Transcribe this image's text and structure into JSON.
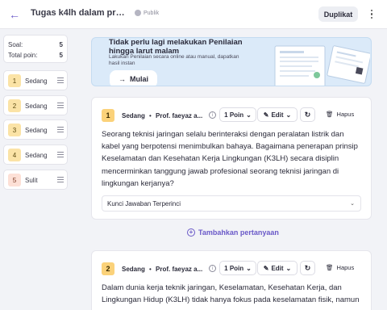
{
  "header": {
    "title": "Tugas k4lh dalam profesi d...",
    "visibility": "Publik",
    "duplicate_label": "Duplikat"
  },
  "stats": {
    "soal_label": "Soal:",
    "soal_value": "5",
    "poin_label": "Total poin:",
    "poin_value": "5"
  },
  "sidebar": {
    "items": [
      {
        "number": "1",
        "difficulty": "Sedang"
      },
      {
        "number": "2",
        "difficulty": "Sedang"
      },
      {
        "number": "3",
        "difficulty": "Sedang"
      },
      {
        "number": "4",
        "difficulty": "Sedang"
      },
      {
        "number": "5",
        "difficulty": "Sulit"
      }
    ]
  },
  "banner": {
    "title": "Tidak perlu lagi melakukan Penilaian hingga larut malam",
    "subtitle": "Lakukan Penilaian secara online atau manual, dapatkan hasil instan",
    "button": "Mulai"
  },
  "questions": [
    {
      "number": "1",
      "difficulty": "Sedang",
      "author": "Prof. faeyaz a...",
      "points": "1 Poin",
      "edit": "Edit",
      "delete": "Hapus",
      "text": "Seorang teknisi jaringan selalu berinteraksi dengan peralatan listrik dan kabel yang berpotensi menimbulkan bahaya. Bagaimana penerapan prinsip Keselamatan dan Kesehatan Kerja Lingkungan (K3LH) secara disiplin mencerminkan tanggung jawab profesional seorang teknisi jaringan di lingkungan kerjanya?",
      "answer_label": "Kunci Jawaban Terperinci"
    },
    {
      "number": "2",
      "difficulty": "Sedang",
      "author": "Prof. faeyaz a...",
      "points": "1 Poin",
      "edit": "Edit",
      "delete": "Hapus",
      "text": "Dalam dunia kerja teknik jaringan, Keselamatan, Kesehatan Kerja, dan Lingkungan Hidup (K3LH) tidak hanya fokus pada keselamatan fisik, namun"
    }
  ],
  "add_question": "Tambahkan pertanyaan",
  "colors": {
    "accent": "#6a59c8",
    "medium_badge": "#fbd27a",
    "hard_badge": "#fde0d6",
    "banner_bg": "#dbeaf9"
  },
  "icons": {
    "back": "arrow-left-icon",
    "visibility": "globe-icon",
    "more": "more-vertical-icon",
    "drag": "drag-handle-icon",
    "info": "info-icon",
    "edit": "pencil-icon",
    "regenerate": "refresh-icon",
    "delete": "trash-icon",
    "add": "plus-circle-icon"
  }
}
